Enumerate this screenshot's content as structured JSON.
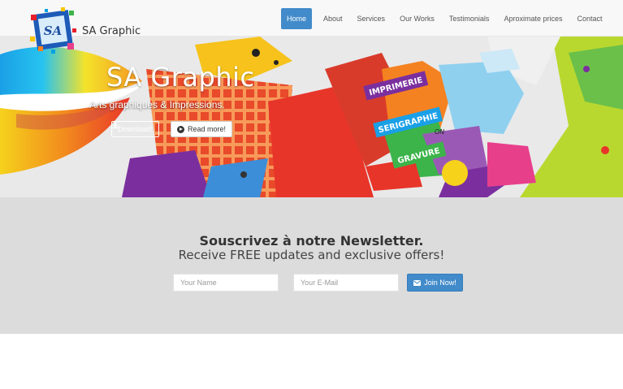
{
  "brand": {
    "name": "SA Graphic",
    "logo_text": "SA"
  },
  "nav": {
    "items": [
      {
        "label": "Home",
        "active": true
      },
      {
        "label": "About"
      },
      {
        "label": "Services"
      },
      {
        "label": "Our Works"
      },
      {
        "label": "Testimonials"
      },
      {
        "label": "Aproximate prices"
      },
      {
        "label": "Contact"
      }
    ]
  },
  "hero": {
    "title": "SA Graphic",
    "subtitle": "Arts graphiques & Impressions.",
    "download_label": "Download!",
    "readmore_label": "Read more!",
    "banner_words": [
      "IMPRIMERIE",
      "SERIGRAPHIE",
      "ON",
      "GRAVURE"
    ]
  },
  "newsletter": {
    "title": "Souscrivez à notre Newsletter.",
    "subtitle": "Receive FREE updates and exclusive offers!",
    "name_placeholder": "Your Name",
    "email_placeholder": "Your E-Mail",
    "join_label": "Join Now!"
  },
  "colors": {
    "primary": "#428bca",
    "navbar_bg": "#f8f8f8",
    "newsletter_bg": "#dcdcdc"
  },
  "icons": {
    "download": "download-icon",
    "readmore": "circle-arrow-right-icon",
    "join": "envelope-icon"
  }
}
